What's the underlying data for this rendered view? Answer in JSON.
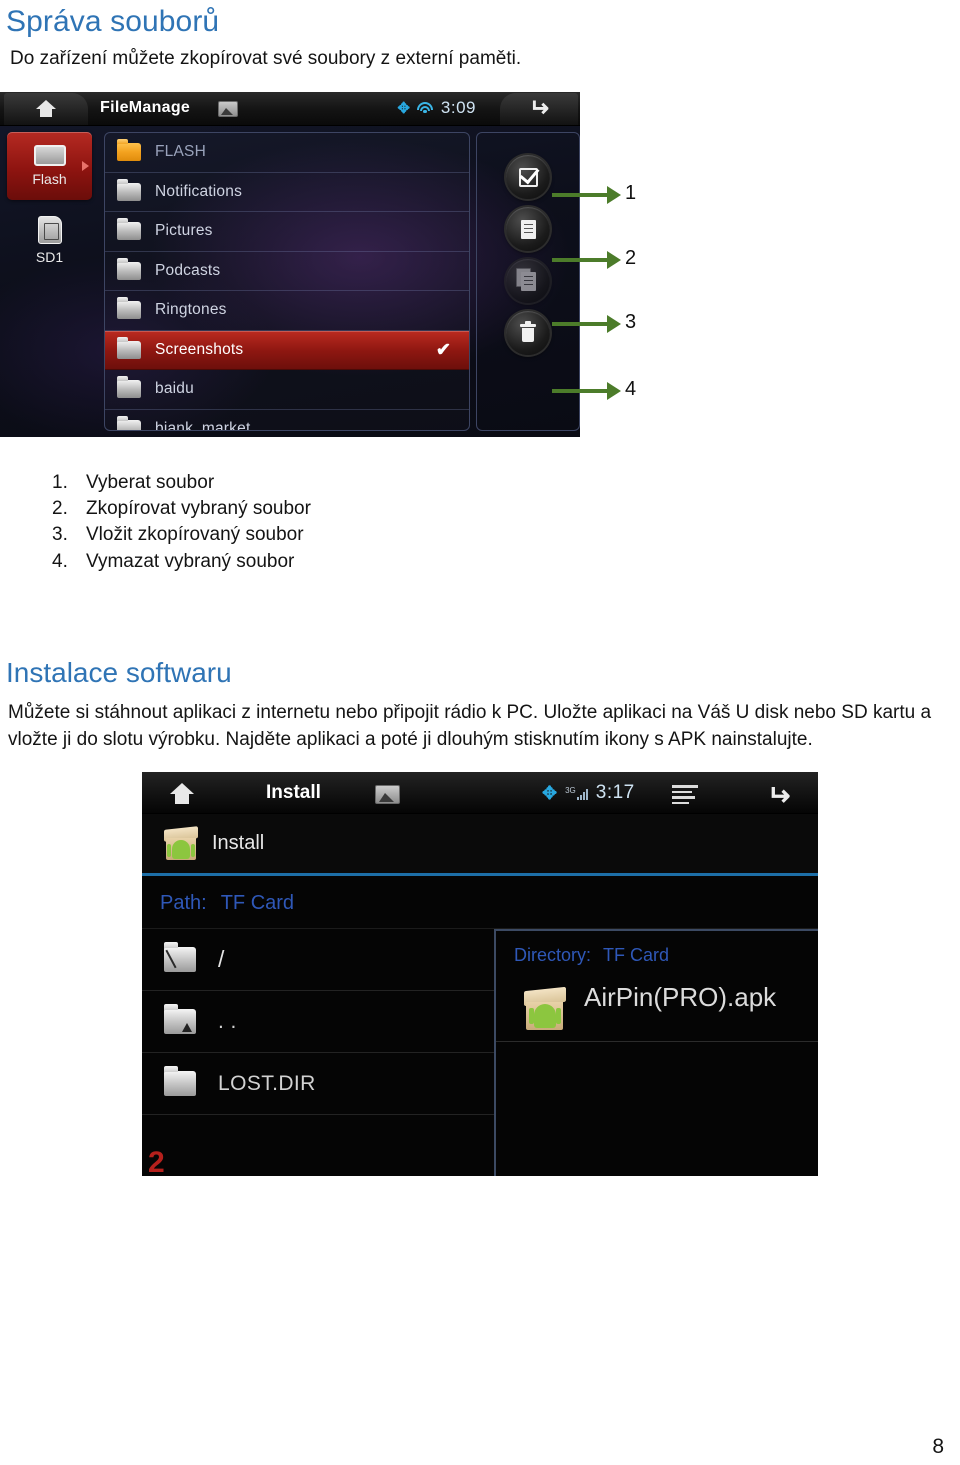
{
  "document": {
    "heading1": "Správa souborů",
    "intro": "Do zařízení můžete zkopírovat své soubory z externí paměti.",
    "heading2": "Instalace softwaru",
    "paragraph2": "Můžete si stáhnout aplikaci z internetu nebo připojit rádio k PC. Uložte aplikaci na Váš U disk nebo SD kartu a vložte ji do slotu výrobku. Najděte aplikaci a poté ji dlouhým stisknutím ikony s APK nainstalujte.",
    "page_number": "8"
  },
  "callouts": {
    "numbers": [
      "1",
      "2",
      "3",
      "4"
    ],
    "arrow_color": "#4c7c2a"
  },
  "steps": [
    {
      "num": "1.",
      "text": "Vyberat soubor"
    },
    {
      "num": "2.",
      "text": "Zkopírovat vybraný soubor"
    },
    {
      "num": "3.",
      "text": "Vložit zkopírovaný soubor"
    },
    {
      "num": "4.",
      "text": "Vymazat vybraný soubor"
    }
  ],
  "screenshot_filemanage": {
    "home_icon": "home-icon",
    "title": "FileManage",
    "image_icon": "image-icon",
    "status": {
      "bluetooth_icon": "bluetooth-icon",
      "wifi_icon": "wifi-icon",
      "clock": "3:09"
    },
    "back_icon": "back-arrow-icon",
    "drives": [
      {
        "label": "Flash",
        "icon": "flash-drive-icon",
        "active": true
      },
      {
        "label": "SD1",
        "icon": "sd-card-icon",
        "active": false
      }
    ],
    "files": [
      {
        "name": "FLASH",
        "icon": "folder-icon-orange",
        "selected": false,
        "checked": false,
        "dim": true
      },
      {
        "name": "Notifications",
        "icon": "folder-icon",
        "selected": false,
        "checked": false
      },
      {
        "name": "Pictures",
        "icon": "folder-icon",
        "selected": false,
        "checked": false
      },
      {
        "name": "Podcasts",
        "icon": "folder-icon",
        "selected": false,
        "checked": false
      },
      {
        "name": "Ringtones",
        "icon": "folder-icon",
        "selected": false,
        "checked": false
      },
      {
        "name": "Screenshots",
        "icon": "folder-icon",
        "selected": true,
        "checked": true
      },
      {
        "name": "baidu",
        "icon": "folder-icon",
        "selected": false,
        "checked": false
      },
      {
        "name": "biank_market",
        "icon": "folder-icon",
        "selected": false,
        "checked": false
      }
    ],
    "check_glyph": "✔",
    "actions": [
      {
        "name": "select-file-button",
        "icon": "checkbox-select-icon"
      },
      {
        "name": "copy-file-button",
        "icon": "copy-document-icon"
      },
      {
        "name": "paste-file-button",
        "icon": "paste-document-icon"
      },
      {
        "name": "delete-file-button",
        "icon": "trash-icon"
      }
    ]
  },
  "screenshot_install": {
    "home_icon": "home-icon",
    "title": "Install",
    "image_icon": "image-icon",
    "status": {
      "bluetooth_icon": "bluetooth-icon",
      "network_label": "3G",
      "signal_icon": "signal-bars-icon",
      "clock": "3:17"
    },
    "list_icon": "list-icon",
    "back_icon": "back-arrow-icon",
    "install_label": "Install",
    "install_icon": "apk-package-icon",
    "path_key": "Path:",
    "path_value": "TF Card",
    "files": [
      {
        "name": "/",
        "icon": "folder-root-icon"
      },
      {
        "name": ". .",
        "icon": "folder-up-icon"
      },
      {
        "name": "LOST.DIR",
        "icon": "folder-icon"
      }
    ],
    "directory_key": "Directory:",
    "directory_value": "TF Card",
    "apk_file": "AirPin(PRO).apk",
    "apk_icon": "apk-package-icon",
    "watermark": "2"
  }
}
